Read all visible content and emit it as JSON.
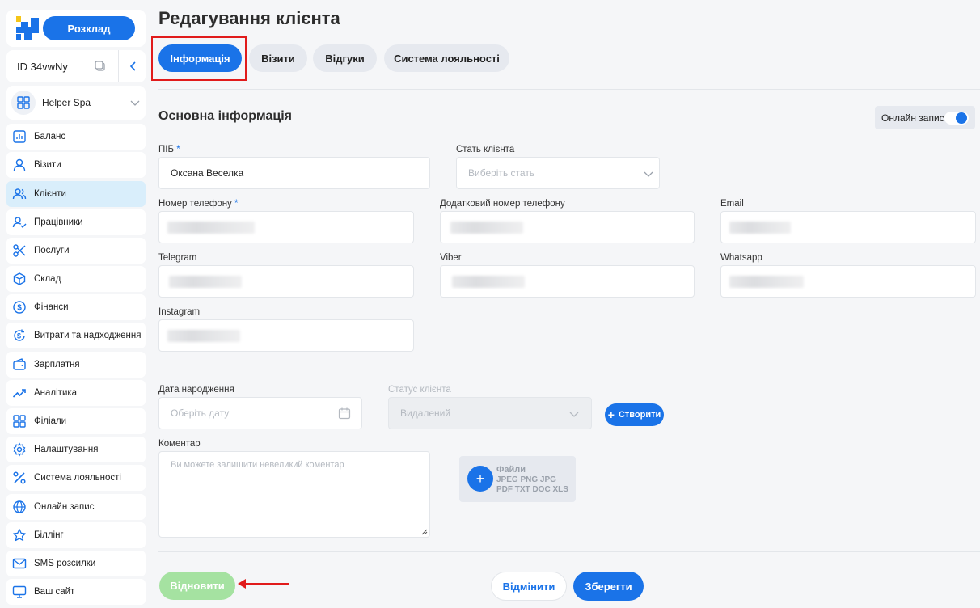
{
  "header": {
    "schedule_label": "Розклад",
    "id_label": "ID 34vwNy",
    "branch_name": "Helper Spa"
  },
  "sidebar": {
    "items": [
      {
        "label": "Баланс",
        "icon": "chart-icon"
      },
      {
        "label": "Візити",
        "icon": "user-icon"
      },
      {
        "label": "Клієнти",
        "icon": "users-icon",
        "active": true
      },
      {
        "label": "Працівники",
        "icon": "employee-check-icon"
      },
      {
        "label": "Послуги",
        "icon": "scissors-icon"
      },
      {
        "label": "Склад",
        "icon": "box-icon"
      },
      {
        "label": "Фінанси",
        "icon": "dollar-icon"
      },
      {
        "label": "Витрати та надходження",
        "icon": "cashflow-icon"
      },
      {
        "label": "Зарплатня",
        "icon": "wallet-icon"
      },
      {
        "label": "Аналітика",
        "icon": "trend-icon"
      },
      {
        "label": "Філіали",
        "icon": "grid-icon"
      },
      {
        "label": "Налаштування",
        "icon": "gear-icon"
      },
      {
        "label": "Система лояльності",
        "icon": "percent-icon"
      },
      {
        "label": "Онлайн запис",
        "icon": "globe-icon"
      },
      {
        "label": "Біллінг",
        "icon": "star-icon"
      },
      {
        "label": "SMS розсилки",
        "icon": "mail-icon"
      },
      {
        "label": "Ваш сайт",
        "icon": "monitor-icon"
      }
    ]
  },
  "page": {
    "title": "Редагування клієнта"
  },
  "tabs": [
    {
      "label": "Інформація",
      "active": true
    },
    {
      "label": "Візити"
    },
    {
      "label": "Відгуки"
    },
    {
      "label": "Система лояльності"
    }
  ],
  "section": {
    "title": "Основна інформація",
    "online_label": "Онлайн запис",
    "online_enabled": true
  },
  "form": {
    "full_name": {
      "label": "ПІБ",
      "required": "*",
      "value": "Оксана Веселка"
    },
    "gender": {
      "label": "Стать клієнта",
      "placeholder": "Виберіть стать"
    },
    "phone": {
      "label": "Номер телефону",
      "required": "*"
    },
    "phone_extra": {
      "label": "Додатковий номер телефону"
    },
    "email": {
      "label": "Email"
    },
    "telegram": {
      "label": "Telegram"
    },
    "viber": {
      "label": "Viber"
    },
    "whatsapp": {
      "label": "Whatsapp"
    },
    "instagram": {
      "label": "Instagram"
    },
    "birthdate": {
      "label": "Дата народження",
      "placeholder": "Оберіть дату"
    },
    "status": {
      "label": "Статус клієнта",
      "value": "Видалений"
    },
    "create_label": "Створити",
    "comment": {
      "label": "Коментар",
      "placeholder": "Ви можете залишити невеликий коментар"
    },
    "files": {
      "title": "Файли",
      "types": "JPEG PNG JPG PDF TXT DOC XLS"
    }
  },
  "actions": {
    "restore_label": "Відновити",
    "cancel_label": "Відмінити",
    "save_label": "Зберегти"
  },
  "colors": {
    "accent": "#1a73e8",
    "restore": "#a5e2a1",
    "highlight": "#e11b1b",
    "active_nav": "#d9eefb"
  }
}
